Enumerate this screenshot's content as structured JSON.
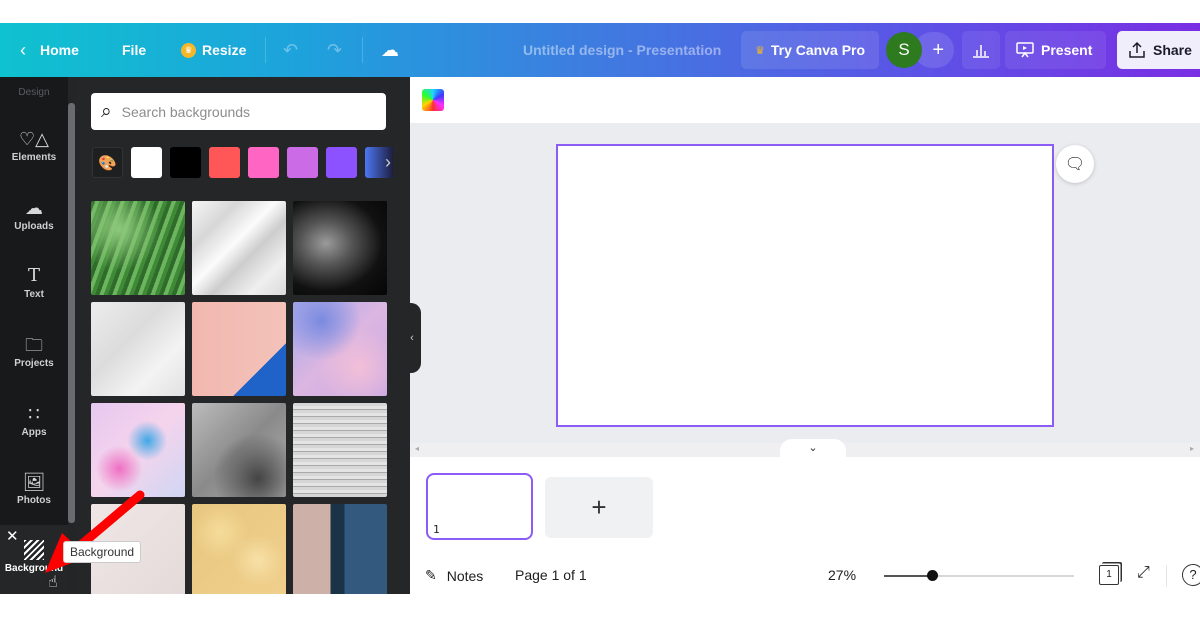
{
  "topbar": {
    "home_label": "Home",
    "file_label": "File",
    "resize_label": "Resize",
    "design_title": "Untitled design - Presentation",
    "try_pro_label": "Try Canva Pro",
    "avatar_initial": "S",
    "present_label": "Present",
    "share_label": "Share",
    "icons": {
      "back": "chevron-left-icon",
      "undo": "undo-icon",
      "redo": "redo-icon",
      "save_status": "cloud-check-icon",
      "stats": "bar-chart-icon",
      "present": "presentation-icon",
      "share": "upload-icon"
    }
  },
  "rail": {
    "items": [
      {
        "label": "Design",
        "icon": "design-icon"
      },
      {
        "label": "Elements",
        "icon": "shapes-icon"
      },
      {
        "label": "Uploads",
        "icon": "cloud-upload-icon"
      },
      {
        "label": "Text",
        "icon": "text-icon"
      },
      {
        "label": "Projects",
        "icon": "folder-icon"
      },
      {
        "label": "Apps",
        "icon": "grid-icon"
      },
      {
        "label": "Photos",
        "icon": "image-icon"
      },
      {
        "label": "Background",
        "icon": "stripes-icon",
        "active": true
      }
    ]
  },
  "panel": {
    "search_placeholder": "Search backgrounds",
    "swatches": [
      "#ffffff",
      "#000000",
      "#ff5757",
      "#ff66c4",
      "#cb6ce6",
      "#8c52ff"
    ],
    "thumbnails": [
      "Palm leaves",
      "White low-poly",
      "Black and white figure",
      "Crumpled paper",
      "Pink with blue fold",
      "Pastel clouds",
      "Marbled pastel",
      "Grey watercolor",
      "Grey lines texture",
      "Floral pale pink",
      "Gold bokeh",
      "Skyscrapers"
    ]
  },
  "editor": {
    "page_number": "1",
    "add_page_label": "+",
    "notes_label": "Notes",
    "page_indicator": "Page 1 of 1",
    "zoom_label": "27%",
    "zoom_value": 27,
    "zoom_slider_fraction": 0.25,
    "page_count_badge": "1",
    "help_label": "?"
  },
  "tooltip": {
    "text": "Background"
  },
  "colors": {
    "accent": "#8b5cf6",
    "annotation_arrow": "#ff0000",
    "avatar": "#2d7a1f"
  }
}
